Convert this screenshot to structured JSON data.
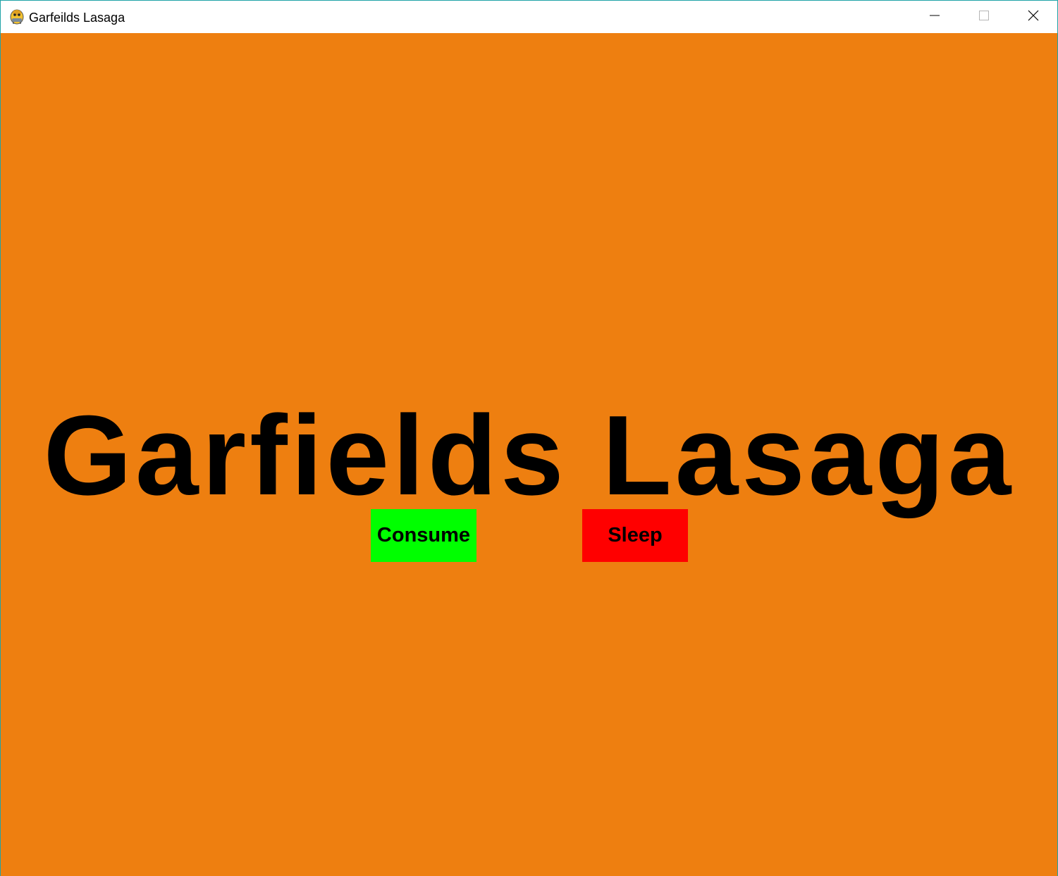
{
  "window": {
    "title": "Garfeilds Lasaga",
    "icon": "pygame-snake-icon",
    "controls": {
      "minimize_icon": "minimize-icon",
      "maximize_icon": "maximize-icon",
      "close_icon": "close-icon"
    }
  },
  "main": {
    "heading": "Garfields Lasaga",
    "background_color": "#ee7f10",
    "buttons": {
      "consume": {
        "label": "Consume",
        "color": "#00ff00"
      },
      "sleep": {
        "label": "Sleep",
        "color": "#ff0000"
      }
    }
  }
}
